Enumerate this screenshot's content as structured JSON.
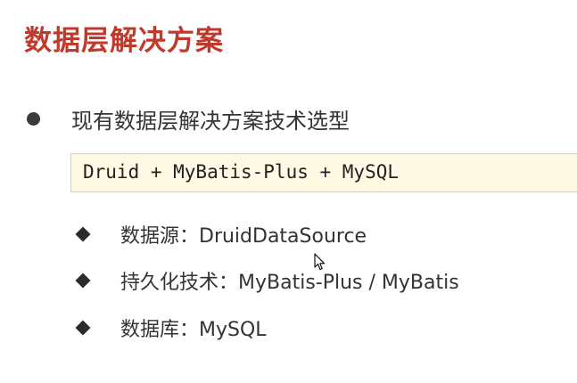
{
  "slide": {
    "title": "数据层解决方案",
    "bullet": {
      "text": "现有数据层解决方案技术选型"
    },
    "code_box": {
      "text": "Druid + MyBatis-Plus + MySQL"
    },
    "items": [
      {
        "text": "数据源：DruidDataSource"
      },
      {
        "text": "持久化技术：MyBatis-Plus / MyBatis"
      },
      {
        "text": "数据库：MySQL"
      }
    ]
  },
  "colors": {
    "title": "#c0392b",
    "code_background": "#fdf9e3",
    "text": "#333333"
  },
  "icons": {
    "bullet": "filled-circle-bullet",
    "sub_bullet": "filled-diamond-bullet",
    "cursor": "mouse-pointer-icon"
  }
}
